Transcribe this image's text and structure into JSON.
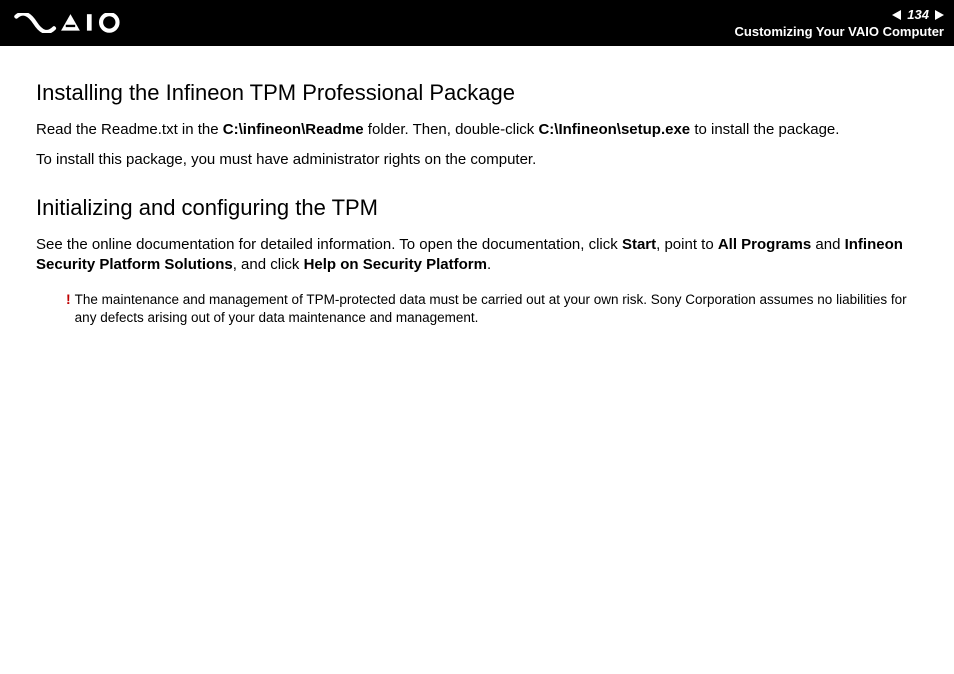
{
  "header": {
    "page_number": "134",
    "section": "Customizing Your VAIO Computer"
  },
  "section1": {
    "heading": "Installing the Infineon TPM Professional Package",
    "p1_a": "Read the Readme.txt in the ",
    "p1_b": "C:\\infineon\\Readme",
    "p1_c": " folder. Then, double-click ",
    "p1_d": "C:\\Infineon\\setup.exe",
    "p1_e": " to install the package.",
    "p2": "To install this package, you must have administrator rights on the computer."
  },
  "section2": {
    "heading": "Initializing and configuring the TPM",
    "p1_a": "See the online documentation for detailed information. To open the documentation, click ",
    "p1_b": "Start",
    "p1_c": ", point to ",
    "p1_d": "All Programs",
    "p1_e": " and ",
    "p1_f": "Infineon Security Platform Solutions",
    "p1_g": ", and click ",
    "p1_h": "Help on Security Platform",
    "p1_i": "."
  },
  "note": {
    "mark": "!",
    "text": "The maintenance and management of TPM-protected data must be carried out at your own risk. Sony Corporation assumes no liabilities for any defects arising out of your data maintenance and management."
  }
}
